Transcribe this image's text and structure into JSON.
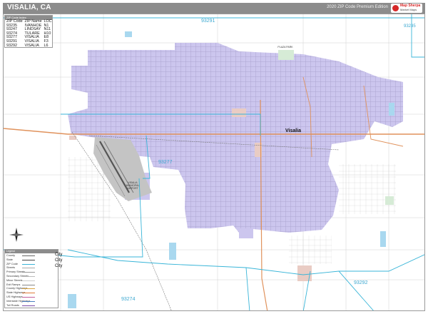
{
  "title": "VISALIA, CA",
  "edition": "2020 ZIP Code Premium Edition",
  "logo": {
    "name": "Map Sherpa",
    "sub": "Market Maps"
  },
  "zip_index": {
    "header": "ZIP Code Index",
    "columns": [
      "ZIP Code",
      "ZIP Name",
      "LOC"
    ],
    "rows": [
      [
        "93235",
        "IVANHOE",
        "N1"
      ],
      [
        "93247",
        "LINDSAY",
        "N11"
      ],
      [
        "93274",
        "TULARE",
        "H10"
      ],
      [
        "93277",
        "VISALIA",
        "E8"
      ],
      [
        "93291",
        "VISALIA",
        "F3"
      ],
      [
        "93292",
        "VISALIA",
        "L6"
      ]
    ]
  },
  "zip_labels": [
    {
      "id": "93291",
      "text": "93291"
    },
    {
      "id": "93235",
      "text": "93235"
    },
    {
      "id": "93277",
      "text": "93277"
    },
    {
      "id": "93292",
      "text": "93292"
    },
    {
      "id": "93274",
      "text": "93274"
    }
  ],
  "city_label": "Visalia",
  "poi_labels": {
    "airport": "VISALIA MUNICIPAL AIRPORT",
    "park": "PLAZA PARK"
  },
  "compass": {
    "north": "N"
  },
  "legend": {
    "header": "Legend",
    "rows": [
      {
        "label": "County",
        "color": "#666666"
      },
      {
        "label": "State",
        "color": "#444444"
      },
      {
        "label": "ZIP Code",
        "color": "#39b5d8"
      },
      {
        "label": "Streets",
        "color": "#aaaaaa"
      },
      {
        "label": "Primary Streets",
        "color": "#999999"
      },
      {
        "label": "Secondary Streets",
        "color": "#bbbbbb"
      },
      {
        "label": "Minor Streets",
        "color": "#cccccc"
      },
      {
        "label": "Exit Ramps",
        "color": "#888888"
      },
      {
        "label": "County Highways",
        "color": "#d9a441"
      },
      {
        "label": "State Highways",
        "color": "#e07b39"
      },
      {
        "label": "US Highways",
        "color": "#c45d9b"
      },
      {
        "label": "Interstate Highways",
        "color": "#4a7fc1"
      },
      {
        "label": "Toll Roads",
        "color": "#7a4aa6"
      }
    ],
    "city_labels": [
      "City",
      "City",
      "City"
    ]
  },
  "colors": {
    "city_fill": "#ccc6ee",
    "zip_boundary": "#39b5d8",
    "highway": "#e0925c",
    "water": "#a9d8ef",
    "railroad": "#777777",
    "airport": "#c4c4c4",
    "parks": "#d6ebd6",
    "landmarks": "#e9ccc4"
  }
}
